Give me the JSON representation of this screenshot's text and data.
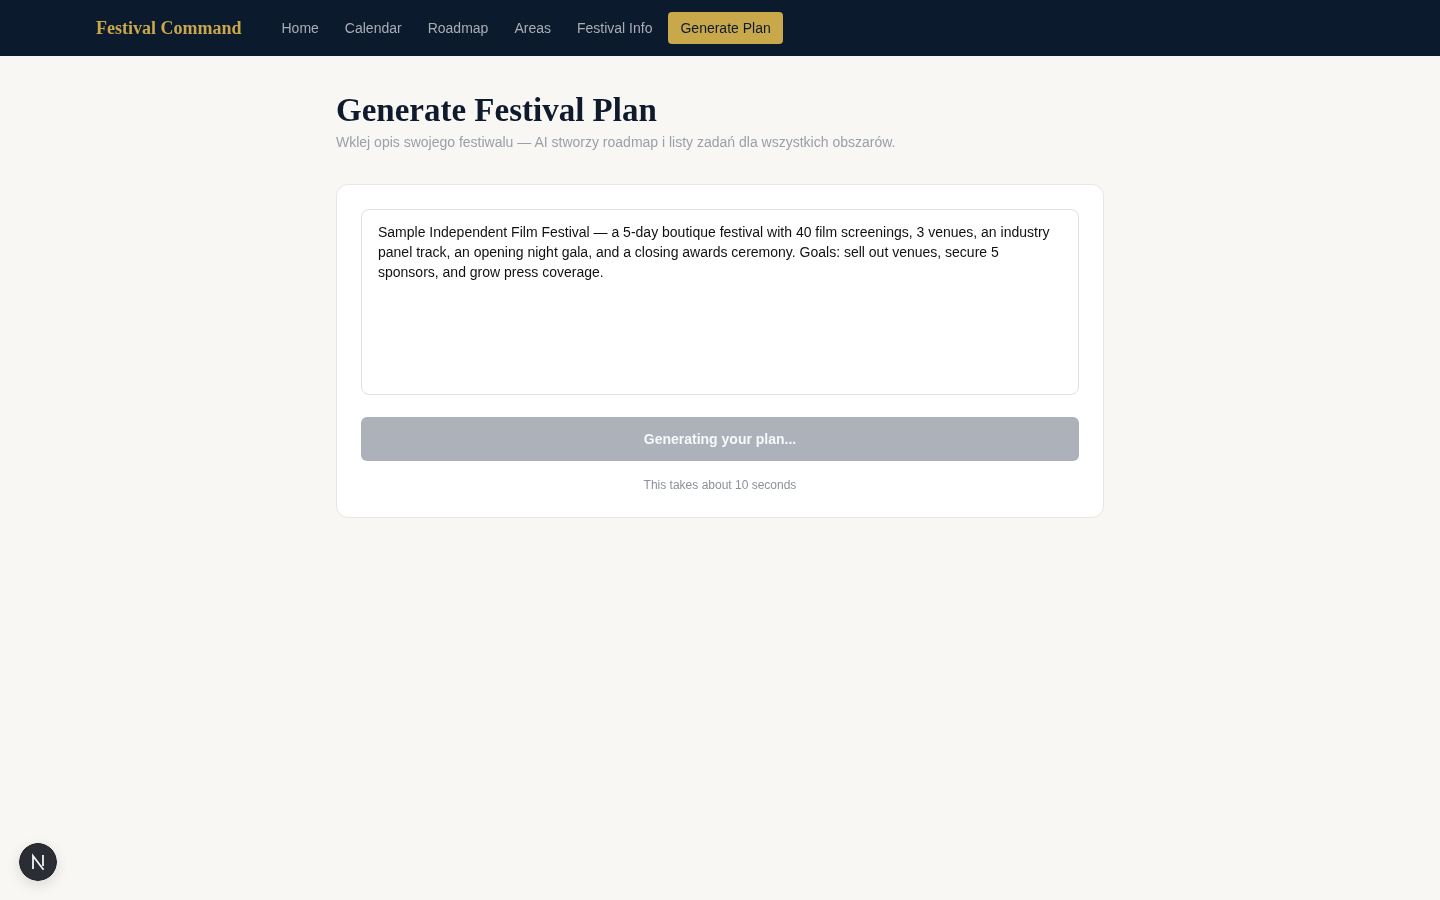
{
  "nav": {
    "brand": "Festival Command",
    "items": [
      {
        "label": "Home",
        "selected": false
      },
      {
        "label": "Calendar",
        "selected": false
      },
      {
        "label": "Roadmap",
        "selected": false
      },
      {
        "label": "Areas",
        "selected": false
      },
      {
        "label": "Festival Info",
        "selected": false
      },
      {
        "label": "Generate Plan",
        "selected": true
      }
    ]
  },
  "page": {
    "title": "Generate Festival Plan",
    "subtitle": "Wklej opis swojego festiwalu — AI stworzy roadmap i listy zadań dla wszystkich obszarów."
  },
  "form": {
    "description": {
      "value": "Sample Independent Film Festival — a 5-day boutique festival with 40 film screenings, 3 venues, an industry panel track, an opening night gala, and a closing awards ceremony. Goals: sell out venues, secure 5 sponsors, and grow press coverage."
    },
    "submit": {
      "label": "Generating your plan...",
      "disabled": true
    },
    "note": "This takes about 10 seconds"
  }
}
